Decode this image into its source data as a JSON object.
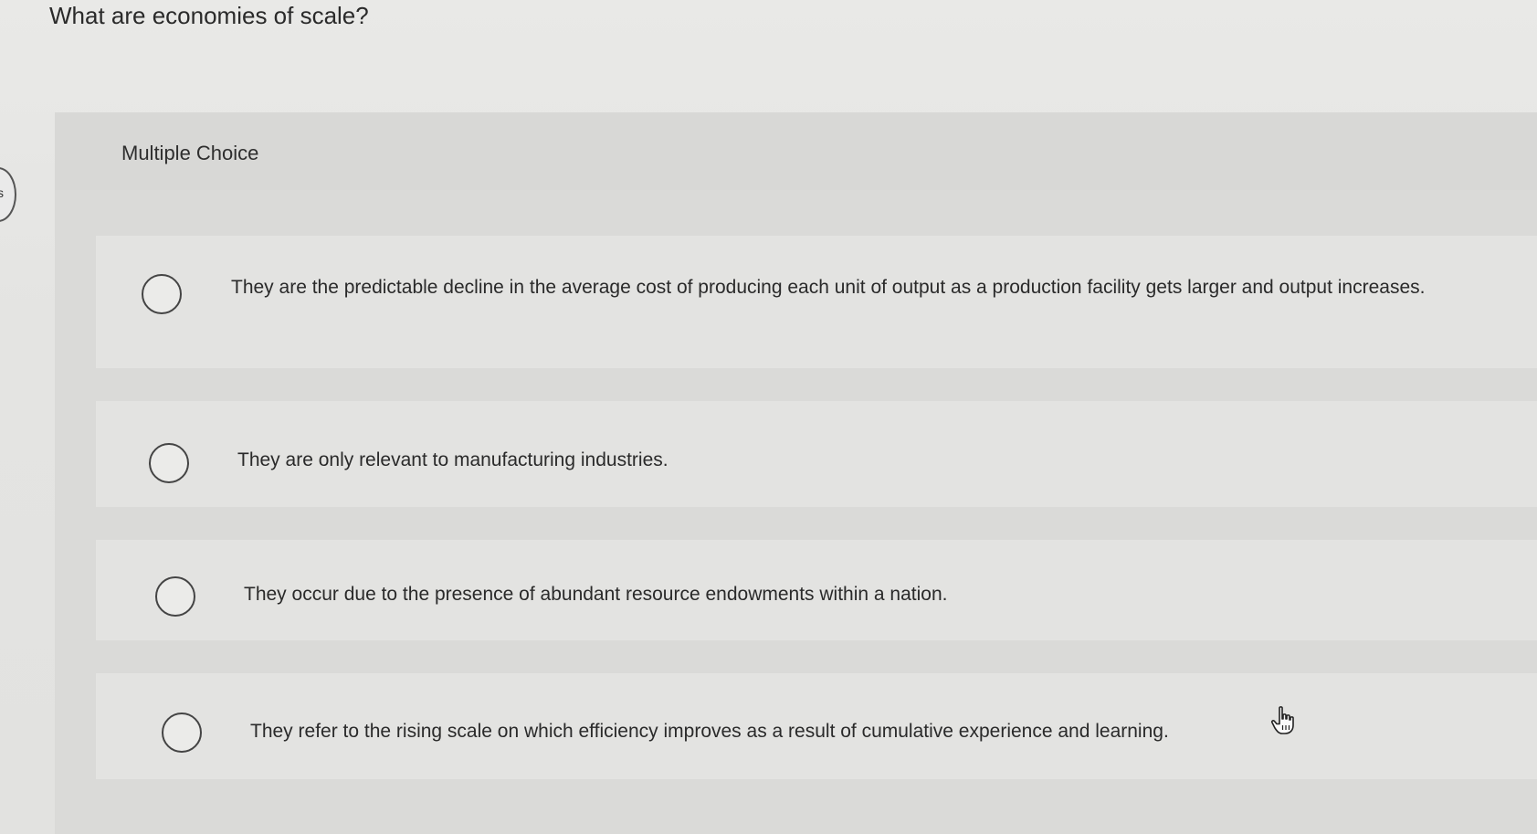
{
  "question": {
    "title": "What are economies of scale?"
  },
  "panel": {
    "type_label": "Multiple Choice"
  },
  "options": [
    {
      "label": "They are the predictable decline in the average cost of producing each unit of output as a production facility gets larger and output increases."
    },
    {
      "label": "They are only relevant to manufacturing industries."
    },
    {
      "label": "They occur due to the presence of abundant resource endowments within a nation."
    },
    {
      "label": "They refer to the rising scale on which efficiency improves as a result of cumulative experience and learning."
    }
  ],
  "sidebar_tab": {
    "text": "s"
  },
  "icons": {
    "cursor": "hand-pointer-icon",
    "radio": "radio-unselected-icon"
  },
  "colors": {
    "background": "#e6e6e4",
    "panel": "#dadad8",
    "option_row": "#e3e3e1",
    "text": "#2a2a2a"
  }
}
